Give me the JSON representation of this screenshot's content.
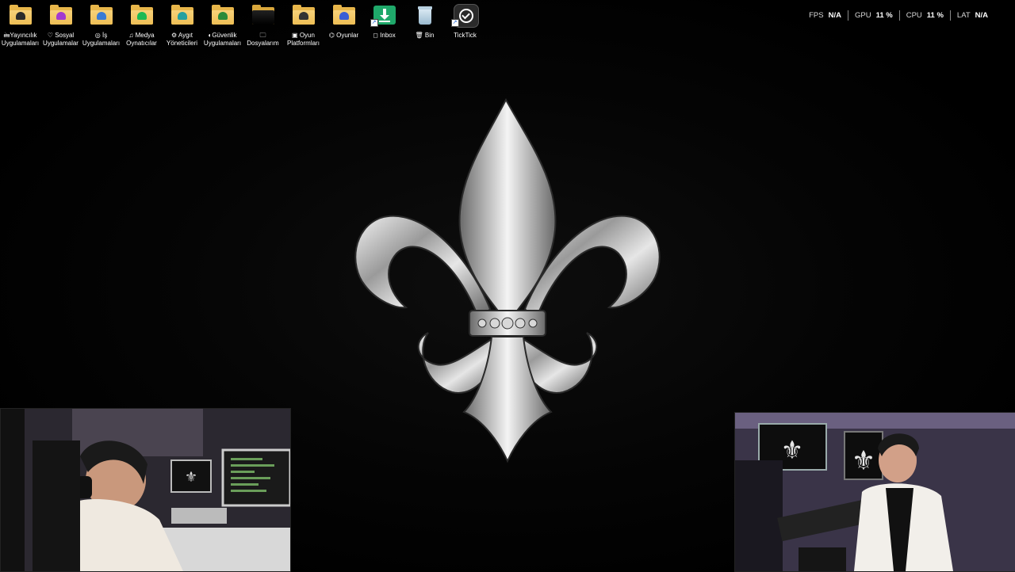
{
  "desktop": {
    "icons": [
      {
        "label1": "🖮Yayıncılık",
        "label2": "Uygulamaları",
        "type": "folder",
        "emblem": "#2b2b2b",
        "icon": "streaming-folder-icon"
      },
      {
        "label1": "♡ Sosyal",
        "label2": "Uygulamalar",
        "type": "folder",
        "emblem": "#a23ad0",
        "icon": "social-folder-icon"
      },
      {
        "label1": "◎ İş",
        "label2": "Uygulamaları",
        "type": "folder",
        "emblem": "#3a7bd5",
        "icon": "work-folder-icon"
      },
      {
        "label1": "♫ Medya",
        "label2": "Oynatıcılar",
        "type": "folder",
        "emblem": "#1db954",
        "icon": "media-folder-icon"
      },
      {
        "label1": "⚙ Aygıt",
        "label2": "Yöneticileri",
        "type": "folder",
        "emblem": "#25a0a0",
        "icon": "device-folder-icon"
      },
      {
        "label1": "◐Güvenlik",
        "label2": "Uygulamaları",
        "type": "folder",
        "emblem": "#2a8a3a",
        "icon": "security-folder-icon"
      },
      {
        "label1": "🗀",
        "label2": "Dosyalarım",
        "type": "folder-dark",
        "emblem": "#111",
        "icon": "files-folder-icon"
      },
      {
        "label1": "▣ Oyun",
        "label2": "Platformları",
        "type": "folder",
        "emblem": "#333",
        "icon": "gaming-platforms-folder-icon"
      },
      {
        "label1": "⌬ Oyunlar",
        "label2": "",
        "type": "folder",
        "emblem": "#3a5fd5",
        "icon": "games-folder-icon"
      },
      {
        "label1": "◻ Inbox",
        "label2": "",
        "type": "inbox",
        "emblem": "#1fa86a",
        "icon": "inbox-download-icon"
      },
      {
        "label1": "🗑 Bin",
        "label2": "",
        "type": "bin",
        "emblem": "#9bbbd0",
        "icon": "recycle-bin-icon"
      },
      {
        "label1": "TickTick",
        "label2": "",
        "type": "ticktick",
        "emblem": "#222",
        "icon": "ticktick-app-icon"
      }
    ]
  },
  "overlay": {
    "fps_label": "FPS",
    "fps_value": "N/A",
    "gpu_label": "GPU",
    "gpu_value": "11 %",
    "cpu_label": "CPU",
    "cpu_value": "11 %",
    "lat_label": "LAT",
    "lat_value": "N/A"
  },
  "colors": {
    "folder": "#e8b64a",
    "background": "#000000",
    "silver": "#c8c8c8"
  }
}
